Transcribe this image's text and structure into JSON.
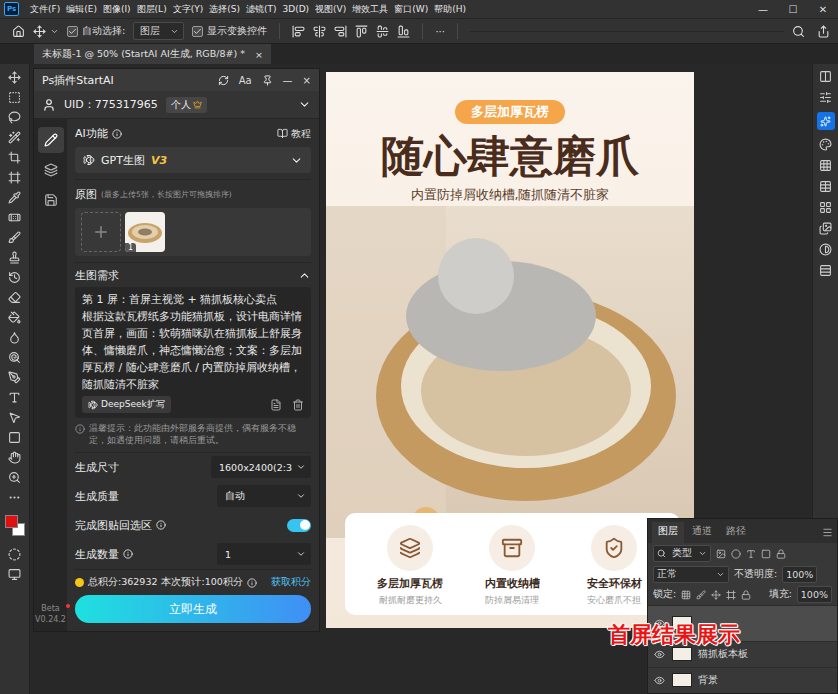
{
  "app_logo": "Ps",
  "menu": [
    "文件(F)",
    "编辑(E)",
    "图像(I)",
    "图层(L)",
    "文字(Y)",
    "选择(S)",
    "滤镜(T)",
    "3D(D)",
    "视图(V)",
    "增效工具",
    "窗口(W)",
    "帮助(H)"
  ],
  "window_controls": [
    "—",
    "☐",
    "✕"
  ],
  "options_bar": {
    "auto_select": {
      "label": "自动选择:",
      "checked": true
    },
    "target": "图层",
    "show_transform": {
      "label": "显示变换控件",
      "checked": true
    },
    "more": "···"
  },
  "document_tab": {
    "title": "未标题-1 @ 50% (StartAI AI生成, RGB/8#) *",
    "close": "×"
  },
  "swatches": [
    {
      "role": "foreground",
      "color": "#e01010"
    },
    {
      "role": "background",
      "color": "#ffffff"
    }
  ],
  "plugin": {
    "title": "Ps插件StartAI",
    "font_button": "Aa",
    "minimize": "—",
    "close": "×",
    "uid": "UID：775317965",
    "badge": "个人",
    "nav": [
      {
        "selected": true
      },
      {
        "selected": false
      },
      {
        "selected": false
      },
      {
        "selected": false
      }
    ],
    "ai_label": "AI功能",
    "tutorial": "教程",
    "model": "GPT生图",
    "model_version": "V3",
    "source_label": "原图",
    "source_hint": "(最多上传5张，长按图片可拖拽排序)",
    "thumbnails": [
      {
        "index": "1"
      }
    ],
    "prompt_title": "生图需求",
    "prompt_expanded": true,
    "prompt_cut": "第 1 屏：首屏主视觉 + 猫抓板核心卖点",
    "prompt": "根据这款瓦楞纸多功能猫抓板，设计电商详情页首屏，画面：软萌猫咪趴在猫抓板上舒展身体、慵懒磨爪，神态慵懒治愈；文案：多层加厚瓦楞 / 随心肆意磨爪 / 内置防掉屑收纳槽，随抓随清不脏家",
    "expand_button": "DeepSeek扩写",
    "tip": "温馨提示：此功能由外部服务商提供，偶有服务不稳定，如遇使用问题，请稍后重试。",
    "settings": [
      {
        "kind": "select",
        "label": "生成尺寸",
        "value": "1600x2400(2:3",
        "info": false
      },
      {
        "kind": "select",
        "label": "生成质量",
        "value": "自动",
        "info": false
      },
      {
        "kind": "toggle",
        "label": "完成图贴回选区",
        "on": true,
        "info": true
      },
      {
        "kind": "select",
        "label": "生成数量",
        "value": "1",
        "info": true
      }
    ],
    "points": "总积分:362932",
    "estimate": "本次预计:100积分",
    "get_points": "获取积分",
    "generate": "立即生成",
    "beta": "Beta",
    "version": "V0.24.2"
  },
  "document": {
    "tag": "多层加厚瓦楞",
    "headline": "随心肆意磨爪",
    "subline": "内置防掉屑收纳槽,随抓随清不脏家",
    "features": [
      {
        "title": "多层加厚瓦楞",
        "sub": "耐抓耐磨更持久"
      },
      {
        "title": "内置收纳槽",
        "sub": "防掉屑易清理"
      },
      {
        "title": "安全环保材",
        "sub": "安心磨爪不担"
      }
    ]
  },
  "layers_panel": {
    "tabs": [
      {
        "label": "图层",
        "selected": true
      },
      {
        "label": "通道",
        "selected": false
      },
      {
        "label": "路径",
        "selected": false
      }
    ],
    "filter": "类型",
    "blend": "正常",
    "opacity_label": "不透明度:",
    "opacity": "100%",
    "lock_label": "锁定:",
    "fill_label": "填充:",
    "fill": "100%",
    "layers": [
      {
        "name": "",
        "selected": true,
        "visible": true
      },
      {
        "name": "猫抓板本板",
        "selected": false,
        "visible": true
      },
      {
        "name": "背景",
        "selected": false,
        "visible": true
      }
    ]
  },
  "annotation": {
    "caption": "首屏结果展示"
  }
}
